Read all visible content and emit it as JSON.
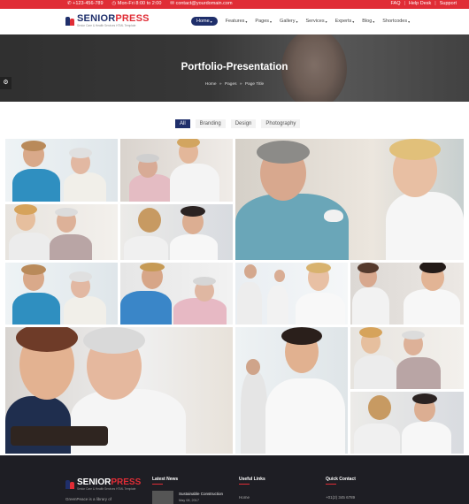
{
  "topbar": {
    "phone": "+123-456-789",
    "hours": "Mon-Fri 8:00 to 2:00",
    "email": "contact@yourdomain.com",
    "links": [
      "FAQ",
      "Help Desk",
      "Support"
    ]
  },
  "brand": {
    "name_a": "SENIOR",
    "name_b": "PRESS",
    "tagline": "Senior Care & Health Services HTML Template"
  },
  "nav": {
    "items": [
      "Home",
      "Features",
      "Pages",
      "Gallery",
      "Services",
      "Experts",
      "Blog",
      "Shortcodes"
    ],
    "active": "Home"
  },
  "hero": {
    "title": "Portfolio-Presentation",
    "breadcrumb": [
      "Home",
      "Pages",
      "Page Title"
    ]
  },
  "filters": {
    "items": [
      "All",
      "Branding",
      "Design",
      "Photography"
    ],
    "active": "All"
  },
  "footer": {
    "brand_a": "SENIOR",
    "brand_b": "PRESS",
    "tagline": "Senior Care & Health Services HTML Template",
    "about": "GreenPeace is a library of",
    "col_news": "Latest News",
    "news_title": "Sustainable Construction",
    "news_date": "May 08, 2017",
    "col_links": "Useful Links",
    "link_home": "Home",
    "col_contact": "Quick Contact",
    "contact_phone": "+01(2) 345 6789"
  },
  "colors": {
    "accent_red": "#e02d36",
    "brand_navy": "#1f2f6b",
    "footer_bg": "#1e1e24"
  },
  "icons": {
    "phone": "phone-icon",
    "clock": "clock-icon",
    "email": "email-icon",
    "sidebar_toggle": "sliders-icon"
  }
}
